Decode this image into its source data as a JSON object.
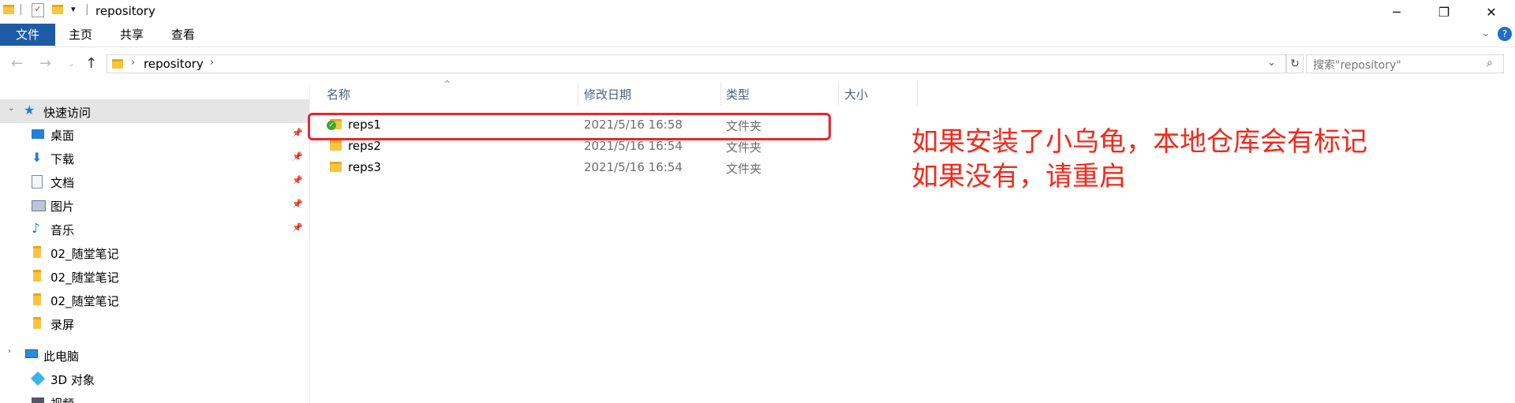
{
  "window": {
    "title": "repository",
    "controls": {
      "minimize": "─",
      "restore": "❐",
      "close": "✕"
    }
  },
  "ribbon": {
    "tabs": [
      {
        "label": "文件",
        "active": true
      },
      {
        "label": "主页",
        "active": false
      },
      {
        "label": "共享",
        "active": false
      },
      {
        "label": "查看",
        "active": false
      }
    ]
  },
  "address": {
    "path": "repository",
    "search_placeholder": "搜索\"repository\""
  },
  "sidebar": {
    "quick_access": "快速访问",
    "items": [
      {
        "label": "桌面",
        "icon": "desktop-icon",
        "pinned": true
      },
      {
        "label": "下载",
        "icon": "download-icon",
        "pinned": true
      },
      {
        "label": "文档",
        "icon": "document-icon",
        "pinned": true
      },
      {
        "label": "图片",
        "icon": "picture-icon",
        "pinned": true
      },
      {
        "label": "音乐",
        "icon": "music-icon",
        "pinned": true
      },
      {
        "label": "02_随堂笔记",
        "icon": "folder-icon",
        "pinned": false
      },
      {
        "label": "02_随堂笔记",
        "icon": "folder-icon",
        "pinned": false
      },
      {
        "label": "02_随堂笔记",
        "icon": "folder-icon",
        "pinned": false
      },
      {
        "label": "录屏",
        "icon": "folder-icon",
        "pinned": false
      }
    ],
    "this_pc": "此电脑",
    "pc_items": [
      {
        "label": "3D 对象",
        "icon": "3d-objects-icon"
      },
      {
        "label": "视频",
        "icon": "video-icon"
      }
    ]
  },
  "columns": {
    "name": "名称",
    "date": "修改日期",
    "type": "类型",
    "size": "大小"
  },
  "files": [
    {
      "name": "reps1",
      "date": "2021/5/16 16:58",
      "type": "文件夹",
      "status": "tortoise-ok"
    },
    {
      "name": "reps2",
      "date": "2021/5/16 16:54",
      "type": "文件夹",
      "status": ""
    },
    {
      "name": "reps3",
      "date": "2021/5/16 16:54",
      "type": "文件夹",
      "status": ""
    }
  ],
  "annotation": {
    "line1": "如果安装了小乌龟，本地仓库会有标记",
    "line2": "如果没有，请重启",
    "color": "#f02a1c"
  }
}
